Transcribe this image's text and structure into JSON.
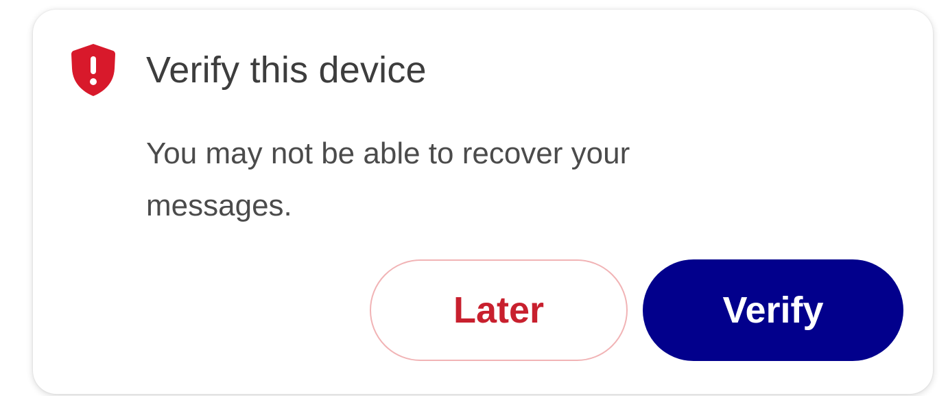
{
  "dialog": {
    "title": "Verify this device",
    "message": "You may not be able to recover your messages.",
    "icon": "shield-alert-icon",
    "buttons": {
      "later_label": "Later",
      "verify_label": "Verify"
    }
  },
  "colors": {
    "shield": "#d8192b",
    "later_text": "#c8202e",
    "later_border": "#f1b3b5",
    "verify_bg": "#02008c",
    "verify_text": "#ffffff"
  }
}
